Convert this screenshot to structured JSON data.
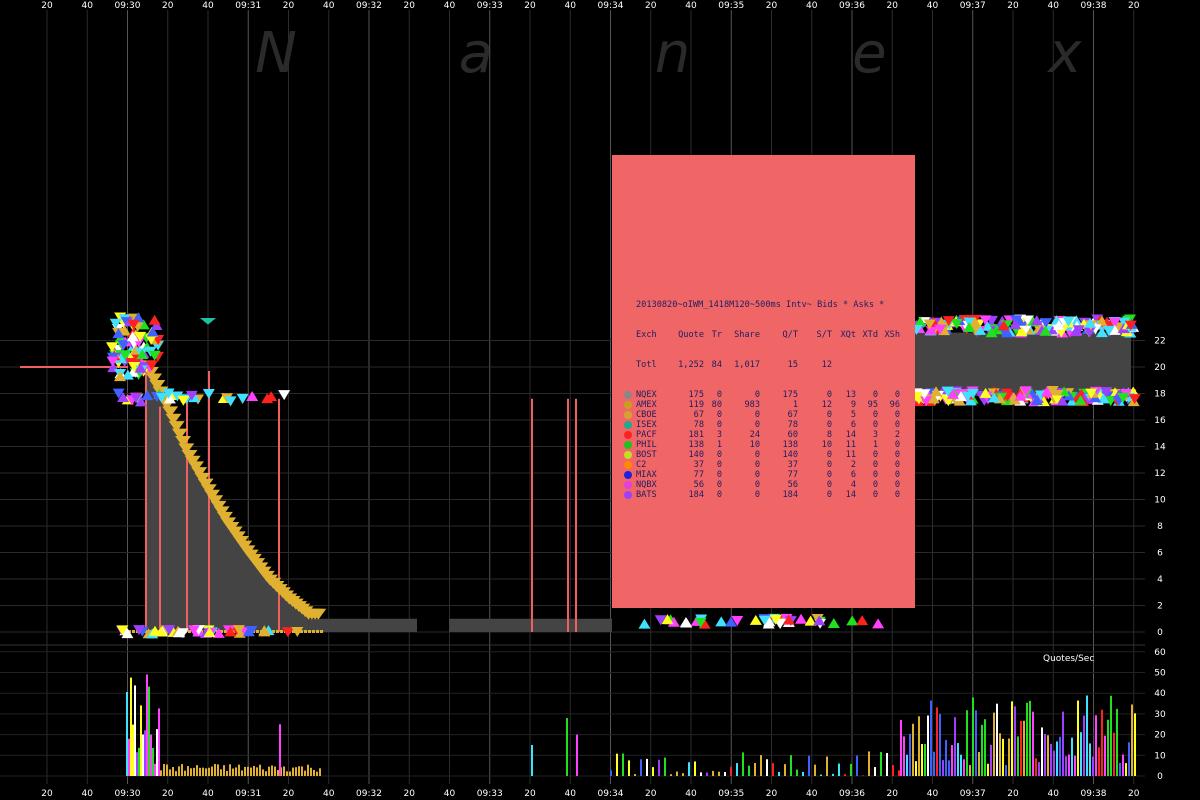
{
  "chart_data": {
    "type": "bar",
    "watermark": "N a n e x",
    "x_tick_labels": [
      "20",
      "40",
      "09:30",
      "20",
      "40",
      "09:31",
      "20",
      "40",
      "09:32",
      "20",
      "40",
      "09:33",
      "20",
      "40",
      "09:34",
      "20",
      "40",
      "09:35",
      "20",
      "40",
      "09:36",
      "20",
      "40",
      "09:37",
      "20",
      "40",
      "09:38",
      "20"
    ],
    "y_tick_labels": [
      "0",
      "2",
      "4",
      "6",
      "8",
      "10",
      "12",
      "14",
      "16",
      "18",
      "20",
      "22"
    ],
    "ylim": [
      0,
      23
    ],
    "lower_panel": {
      "label": "Quotes/Sec",
      "y_tick_labels": [
        "0",
        "10",
        "20",
        "30",
        "40",
        "50",
        "60"
      ],
      "ylim": [
        0,
        62
      ]
    },
    "price_series": {
      "pre_open_level": 20,
      "ask_decay": [
        {
          "t": 9.5,
          "v": 20.2
        },
        {
          "t": 15,
          "v": 18.5
        },
        {
          "t": 20,
          "v": 17.0
        },
        {
          "t": 30,
          "v": 13.5
        },
        {
          "t": 40,
          "v": 10.8
        },
        {
          "t": 50,
          "v": 8.2
        },
        {
          "t": 60,
          "v": 6.0
        },
        {
          "t": 70,
          "v": 4.0
        },
        {
          "t": 80,
          "v": 2.5
        },
        {
          "t": 90,
          "v": 1.3
        }
      ]
    },
    "legend": {
      "title": "20130820~oIWM_1418M120~500ms Intv~ Bids * Asks *",
      "columns": [
        "Exch",
        "Quote",
        "Tr",
        "Share",
        "Q/T",
        "S/T",
        "XQt",
        "XTd",
        "XSh"
      ],
      "total": [
        "Totl",
        "1,252",
        "84",
        "1,017",
        "15",
        "12",
        "",
        "",
        ""
      ],
      "rows": [
        {
          "exch": "NQEX",
          "color": "#888888",
          "vals": [
            "175",
            "0",
            "0",
            "175",
            "0",
            "13",
            "0",
            "0"
          ]
        },
        {
          "exch": "AMEX",
          "color": "#c8a020",
          "vals": [
            "119",
            "80",
            "983",
            "1",
            "12",
            "9",
            "95",
            "96"
          ]
        },
        {
          "exch": "CBOE",
          "color": "#d8a030",
          "vals": [
            "67",
            "0",
            "0",
            "67",
            "0",
            "5",
            "0",
            "0"
          ]
        },
        {
          "exch": "ISEX",
          "color": "#20a890",
          "vals": [
            "78",
            "0",
            "0",
            "78",
            "0",
            "6",
            "0",
            "0"
          ]
        },
        {
          "exch": "PACF",
          "color": "#ff2020",
          "vals": [
            "181",
            "3",
            "24",
            "60",
            "8",
            "14",
            "3",
            "2"
          ]
        },
        {
          "exch": "PHIL",
          "color": "#20c020",
          "vals": [
            "138",
            "1",
            "10",
            "138",
            "10",
            "11",
            "1",
            "0"
          ]
        },
        {
          "exch": "BOST",
          "color": "#c0e020",
          "vals": [
            "140",
            "0",
            "0",
            "140",
            "0",
            "11",
            "0",
            "0"
          ]
        },
        {
          "exch": "C2",
          "color": "#ff8800",
          "vals": [
            "37",
            "0",
            "0",
            "37",
            "0",
            "2",
            "0",
            "0"
          ]
        },
        {
          "exch": "MIAX",
          "color": "#2020e0",
          "vals": [
            "77",
            "0",
            "0",
            "77",
            "0",
            "6",
            "0",
            "0"
          ]
        },
        {
          "exch": "NQBX",
          "color": "#e040e0",
          "vals": [
            "56",
            "0",
            "0",
            "56",
            "0",
            "4",
            "0",
            "0"
          ]
        },
        {
          "exch": "BATS",
          "color": "#a040ff",
          "vals": [
            "184",
            "0",
            "0",
            "184",
            "0",
            "14",
            "0",
            "0"
          ]
        }
      ]
    },
    "colors": {
      "background": "#000000",
      "grid": "#444444",
      "spread_fill": "#444444",
      "ask_marker": "#e0b030",
      "trade_line": "#f06060",
      "legend_bg": "#f06666"
    }
  }
}
